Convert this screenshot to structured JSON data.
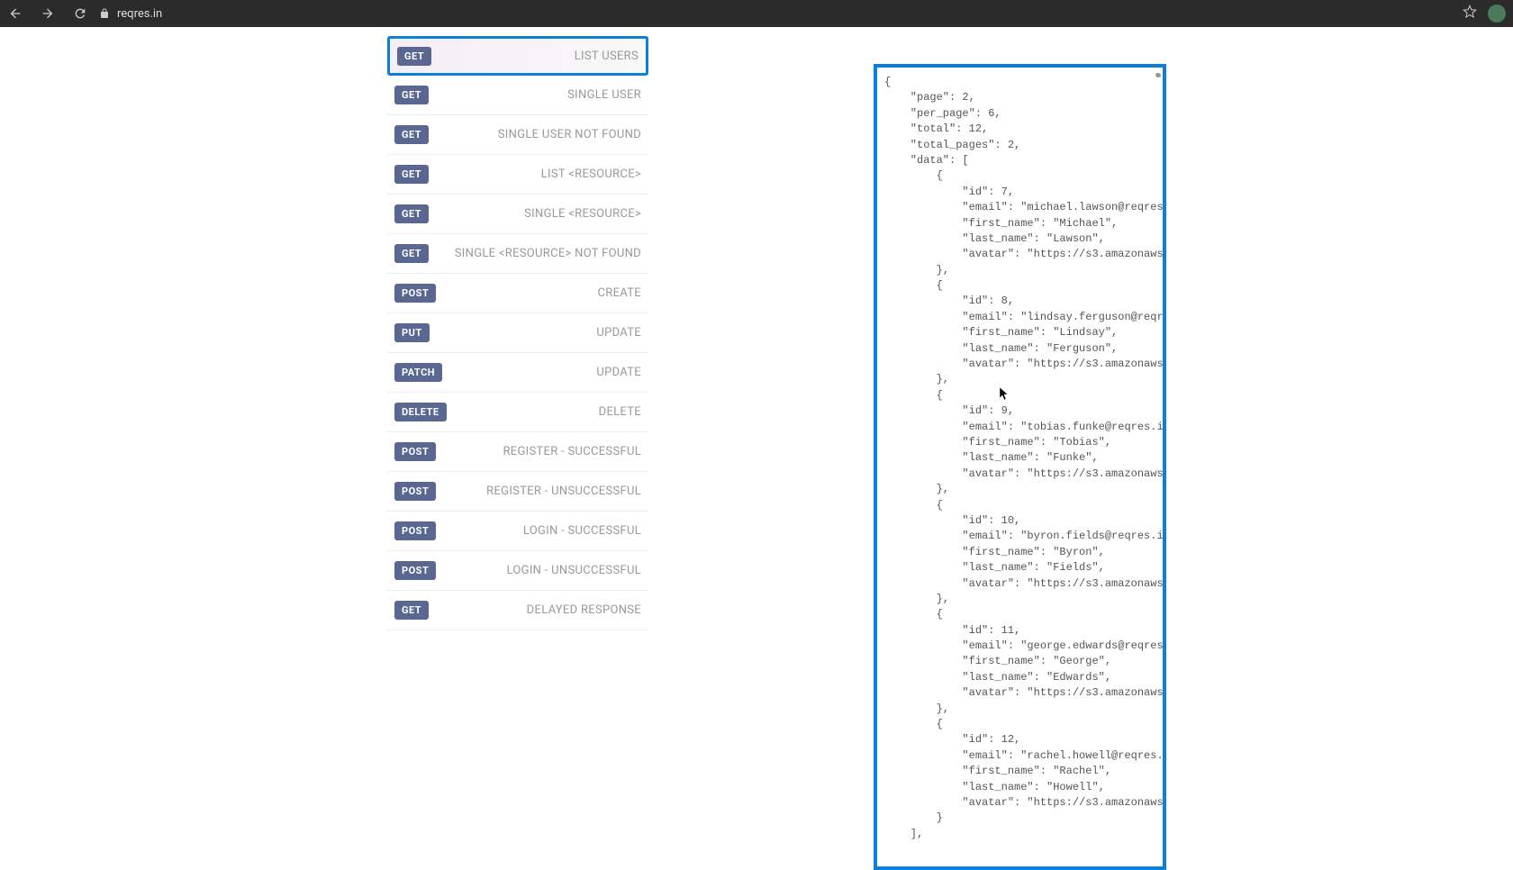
{
  "browser": {
    "url": "reqres.in"
  },
  "endpoints": [
    {
      "method": "GET",
      "label": "LIST USERS",
      "active": true
    },
    {
      "method": "GET",
      "label": "SINGLE USER",
      "active": false
    },
    {
      "method": "GET",
      "label": "SINGLE USER NOT FOUND",
      "active": false
    },
    {
      "method": "GET",
      "label": "LIST <RESOURCE>",
      "active": false
    },
    {
      "method": "GET",
      "label": "SINGLE <RESOURCE>",
      "active": false
    },
    {
      "method": "GET",
      "label": "SINGLE <RESOURCE> NOT FOUND",
      "active": false
    },
    {
      "method": "POST",
      "label": "CREATE",
      "active": false
    },
    {
      "method": "PUT",
      "label": "UPDATE",
      "active": false
    },
    {
      "method": "PATCH",
      "label": "UPDATE",
      "active": false
    },
    {
      "method": "DELETE",
      "label": "DELETE",
      "active": false
    },
    {
      "method": "POST",
      "label": "REGISTER - SUCCESSFUL",
      "active": false
    },
    {
      "method": "POST",
      "label": "REGISTER - UNSUCCESSFUL",
      "active": false
    },
    {
      "method": "POST",
      "label": "LOGIN - SUCCESSFUL",
      "active": false
    },
    {
      "method": "POST",
      "label": "LOGIN - UNSUCCESSFUL",
      "active": false
    },
    {
      "method": "GET",
      "label": "DELAYED RESPONSE",
      "active": false
    }
  ],
  "response_body": "{\n    \"page\": 2,\n    \"per_page\": 6,\n    \"total\": 12,\n    \"total_pages\": 2,\n    \"data\": [\n        {\n            \"id\": 7,\n            \"email\": \"michael.lawson@reqres.\n            \"first_name\": \"Michael\",\n            \"last_name\": \"Lawson\",\n            \"avatar\": \"https://s3.amazonaws.\n        },\n        {\n            \"id\": 8,\n            \"email\": \"lindsay.ferguson@reqre\n            \"first_name\": \"Lindsay\",\n            \"last_name\": \"Ferguson\",\n            \"avatar\": \"https://s3.amazonaws.\n        },\n        {\n            \"id\": 9,\n            \"email\": \"tobias.funke@reqres.in\n            \"first_name\": \"Tobias\",\n            \"last_name\": \"Funke\",\n            \"avatar\": \"https://s3.amazonaws.\n        },\n        {\n            \"id\": 10,\n            \"email\": \"byron.fields@reqres.in\n            \"first_name\": \"Byron\",\n            \"last_name\": \"Fields\",\n            \"avatar\": \"https://s3.amazonaws.\n        },\n        {\n            \"id\": 11,\n            \"email\": \"george.edwards@reqres.\n            \"first_name\": \"George\",\n            \"last_name\": \"Edwards\",\n            \"avatar\": \"https://s3.amazonaws.\n        },\n        {\n            \"id\": 12,\n            \"email\": \"rachel.howell@reqres.i\n            \"first_name\": \"Rachel\",\n            \"last_name\": \"Howell\",\n            \"avatar\": \"https://s3.amazonaws.\n        }\n    ],"
}
